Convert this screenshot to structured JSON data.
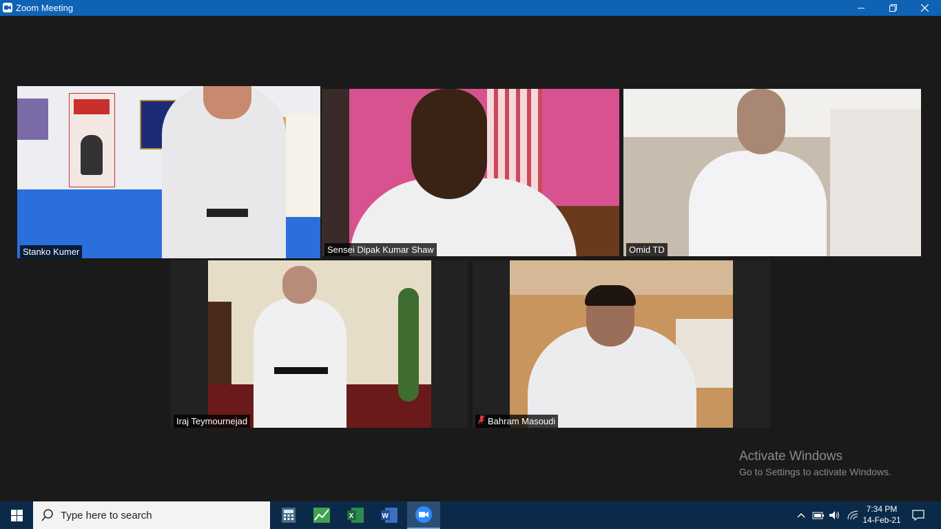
{
  "window": {
    "title": "Zoom Meeting",
    "buttons": {
      "minimize": "minimize",
      "maximize": "restore",
      "close": "close"
    }
  },
  "participants": [
    {
      "name": "Stanko Kumer",
      "active_speaker": true,
      "muted": false
    },
    {
      "name": "Sensei Dipak Kumar Shaw",
      "active_speaker": false,
      "muted": false
    },
    {
      "name": "Omid TD",
      "active_speaker": false,
      "muted": false
    },
    {
      "name": "Iraj Teymournejad",
      "active_speaker": false,
      "muted": false
    },
    {
      "name": "Bahram Masoudi",
      "active_speaker": false,
      "muted": true
    }
  ],
  "watermark": {
    "line1": "Activate Windows",
    "line2": "Go to Settings to activate Windows."
  },
  "taskbar": {
    "search_placeholder": "Type here to search",
    "apps": [
      "calculator-icon",
      "finance-chart-icon",
      "excel-icon",
      "word-icon",
      "zoom-icon"
    ],
    "active_app": "zoom-icon",
    "clock": {
      "time": "7:34 PM",
      "date": "14-Feb-21"
    }
  },
  "colors": {
    "titlebar": "#0e63b4",
    "active_speaker_border": "#d4e157",
    "taskbar": "#0b2a4a",
    "muted_icon": "#e53935"
  }
}
